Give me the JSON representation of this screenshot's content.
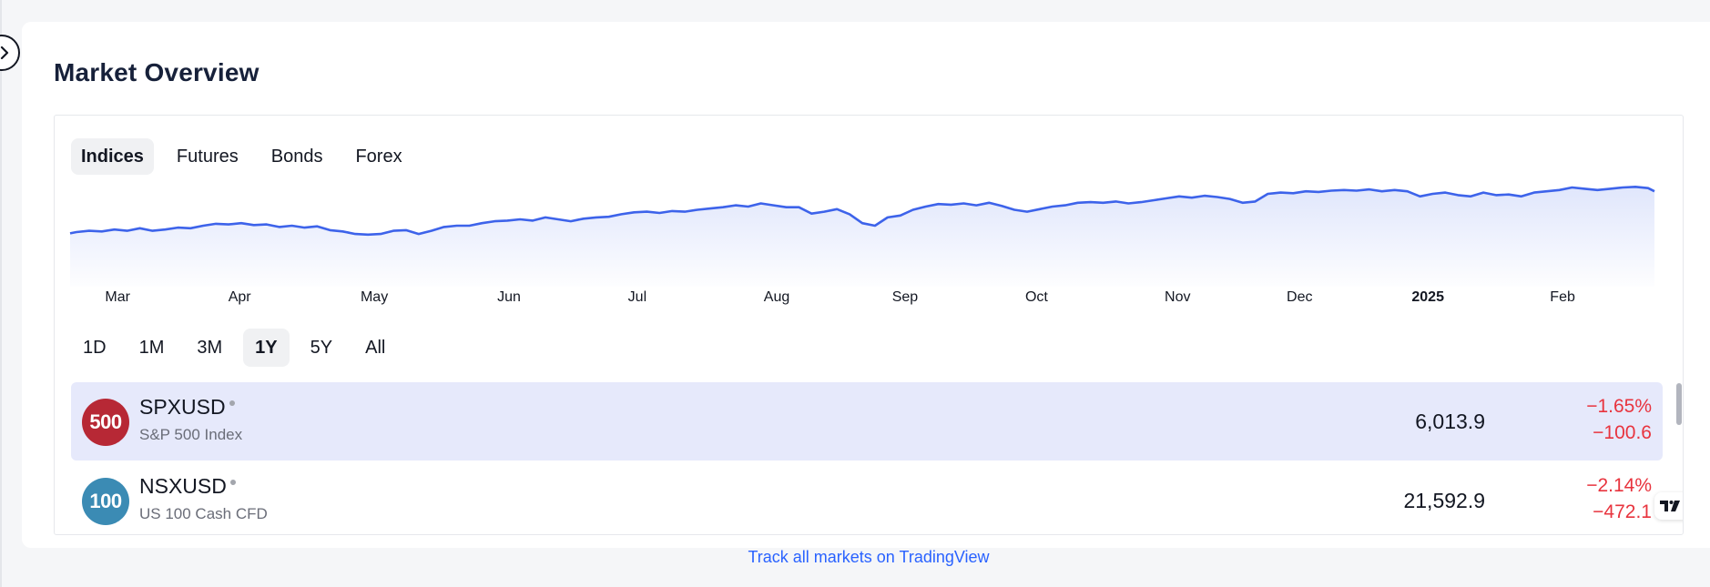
{
  "title": "Market Overview",
  "tabs": [
    "Indices",
    "Futures",
    "Bonds",
    "Forex"
  ],
  "active_tab": "Indices",
  "chart": {
    "series_color": "#3d63ea",
    "months": [
      "Mar",
      "Apr",
      "May",
      "Jun",
      "Jul",
      "Aug",
      "Sep",
      "Oct",
      "Nov",
      "Dec",
      "2025",
      "Feb"
    ],
    "month_positions": [
      0.03,
      0.107,
      0.192,
      0.277,
      0.358,
      0.446,
      0.527,
      0.61,
      0.699,
      0.776,
      0.857,
      0.942
    ]
  },
  "ranges": [
    "1D",
    "1M",
    "3M",
    "1Y",
    "5Y",
    "All"
  ],
  "active_range": "1Y",
  "rows": [
    {
      "logo_text": "500",
      "logo_color": "#b72835",
      "symbol": "SPXUSD",
      "description": "S&P 500 Index",
      "price": "6,013.9",
      "change_percent": "−1.65%",
      "change_abs": "−100.6"
    },
    {
      "logo_text": "100",
      "logo_color": "#3b8bb4",
      "symbol": "NSXUSD",
      "description": "US 100 Cash CFD",
      "price": "21,592.9",
      "change_percent": "−2.14%",
      "change_abs": "−472.1"
    }
  ],
  "footer_link": "Track all markets on TradingView",
  "colors": {
    "accent": "#2962ff",
    "negative": "#e8343e",
    "selected_row": "#e6e9fb"
  }
}
